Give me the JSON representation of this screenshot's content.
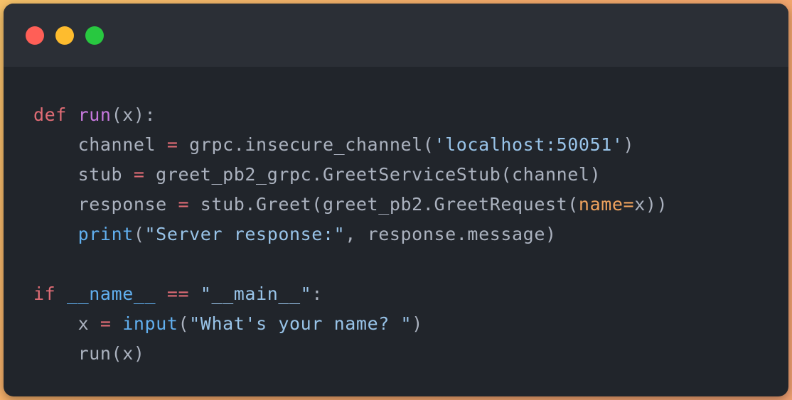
{
  "window": {
    "controls": [
      {
        "name": "close",
        "color": "#ff5f57"
      },
      {
        "name": "minimize",
        "color": "#febc2e"
      },
      {
        "name": "maximize",
        "color": "#28c840"
      }
    ]
  },
  "code": {
    "language": "python",
    "lines": [
      [
        {
          "t": "def",
          "c": "kw"
        },
        {
          "t": " ",
          "c": "plain"
        },
        {
          "t": "run",
          "c": "fn"
        },
        {
          "t": "(x):",
          "c": "plain"
        }
      ],
      [
        {
          "t": "    channel ",
          "c": "plain"
        },
        {
          "t": "=",
          "c": "op"
        },
        {
          "t": " grpc.insecure_channel(",
          "c": "plain"
        },
        {
          "t": "'localhost:50051'",
          "c": "str"
        },
        {
          "t": ")",
          "c": "plain"
        }
      ],
      [
        {
          "t": "    stub ",
          "c": "plain"
        },
        {
          "t": "=",
          "c": "op"
        },
        {
          "t": " greet_pb2_grpc.GreetServiceStub(channel)",
          "c": "plain"
        }
      ],
      [
        {
          "t": "    response ",
          "c": "plain"
        },
        {
          "t": "=",
          "c": "op"
        },
        {
          "t": " stub.Greet(greet_pb2.GreetRequest(",
          "c": "plain"
        },
        {
          "t": "name=",
          "c": "param"
        },
        {
          "t": "x))",
          "c": "plain"
        }
      ],
      [
        {
          "t": "    ",
          "c": "plain"
        },
        {
          "t": "print",
          "c": "bi"
        },
        {
          "t": "(",
          "c": "plain"
        },
        {
          "t": "\"Server response:\"",
          "c": "str"
        },
        {
          "t": ", response.message)",
          "c": "plain"
        }
      ],
      [
        {
          "t": " ",
          "c": "plain"
        }
      ],
      [
        {
          "t": "if",
          "c": "kw"
        },
        {
          "t": " ",
          "c": "plain"
        },
        {
          "t": "__name__",
          "c": "bi"
        },
        {
          "t": " ",
          "c": "plain"
        },
        {
          "t": "==",
          "c": "op"
        },
        {
          "t": " ",
          "c": "plain"
        },
        {
          "t": "\"__main__\"",
          "c": "str"
        },
        {
          "t": ":",
          "c": "plain"
        }
      ],
      [
        {
          "t": "    x ",
          "c": "plain"
        },
        {
          "t": "=",
          "c": "op"
        },
        {
          "t": " ",
          "c": "plain"
        },
        {
          "t": "input",
          "c": "bi"
        },
        {
          "t": "(",
          "c": "plain"
        },
        {
          "t": "\"What's your name? \"",
          "c": "str"
        },
        {
          "t": ")",
          "c": "plain"
        }
      ],
      [
        {
          "t": "    run(x)",
          "c": "plain"
        }
      ]
    ]
  },
  "colors": {
    "keyword": "#e06c75",
    "function": "#c678dd",
    "string": "#98c3e8",
    "builtin": "#61afef",
    "parameter": "#f0a35e",
    "text": "#abb2bf",
    "background": "#21252b",
    "titlebar": "#2b2f36"
  }
}
